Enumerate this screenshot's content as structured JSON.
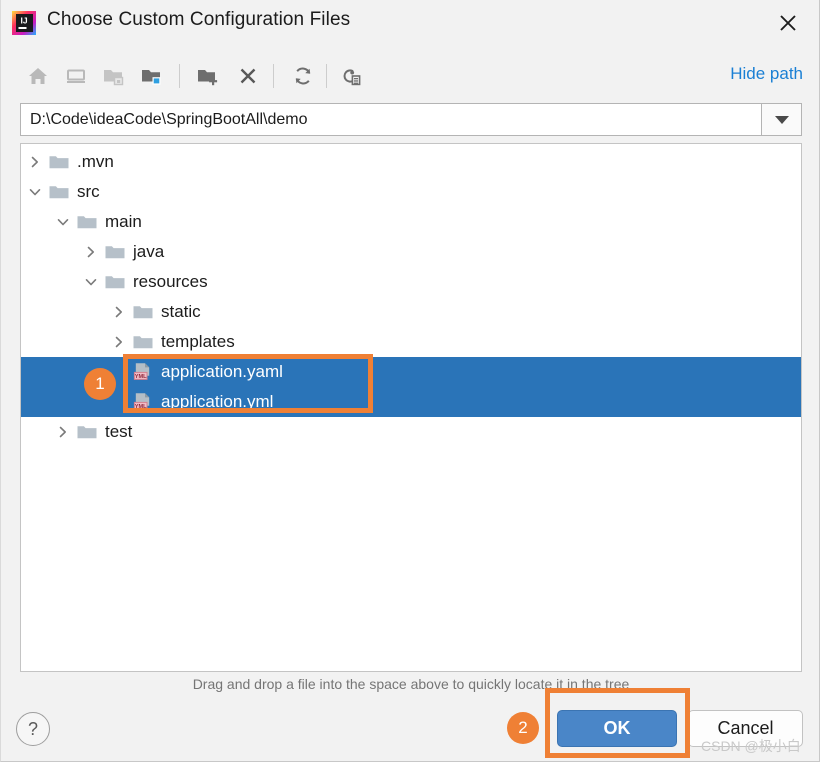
{
  "window": {
    "title": "Choose Custom Configuration Files",
    "app_icon": "intellij-idea-logo",
    "close_icon": "close-icon"
  },
  "toolbar": {
    "items": [
      {
        "name": "home-icon",
        "tooltip": "Home"
      },
      {
        "name": "desktop-icon",
        "tooltip": "Desktop"
      },
      {
        "name": "project-folder-icon",
        "tooltip": "Project Directory"
      },
      {
        "name": "module-folder-icon",
        "tooltip": "Module Directory"
      },
      {
        "name": "new-folder-icon",
        "tooltip": "New Folder"
      },
      {
        "name": "delete-icon",
        "tooltip": "Delete"
      },
      {
        "name": "refresh-icon",
        "tooltip": "Refresh"
      },
      {
        "name": "show-hidden-icon",
        "tooltip": "Show Hidden Files"
      }
    ],
    "hide_path_label": "Hide path"
  },
  "path_field": {
    "value": "D:\\Code\\ideaCode\\SpringBootAll\\demo",
    "placeholder": "",
    "dropdown_icon": "chevron-down-icon"
  },
  "tree": {
    "rows": [
      {
        "label": ".mvn",
        "depth": 0,
        "type": "folder",
        "state": "collapsed",
        "selected": false
      },
      {
        "label": "src",
        "depth": 0,
        "type": "folder",
        "state": "expanded",
        "selected": false
      },
      {
        "label": "main",
        "depth": 1,
        "type": "folder",
        "state": "expanded",
        "selected": false
      },
      {
        "label": "java",
        "depth": 2,
        "type": "folder",
        "state": "collapsed",
        "selected": false
      },
      {
        "label": "resources",
        "depth": 2,
        "type": "folder",
        "state": "expanded",
        "selected": false
      },
      {
        "label": "static",
        "depth": 3,
        "type": "folder",
        "state": "collapsed",
        "selected": false
      },
      {
        "label": "templates",
        "depth": 3,
        "type": "folder",
        "state": "collapsed",
        "selected": false
      },
      {
        "label": "application.yaml",
        "depth": 3,
        "type": "yml",
        "state": "leaf",
        "selected": true
      },
      {
        "label": "application.yml",
        "depth": 3,
        "type": "yml",
        "state": "leaf",
        "selected": true
      },
      {
        "label": "test",
        "depth": 1,
        "type": "folder",
        "state": "collapsed",
        "selected": false
      }
    ]
  },
  "footer": {
    "drag_hint": "Drag and drop a file into the space above to quickly locate it in the tree",
    "help_label": "?",
    "ok_label": "OK",
    "cancel_label": "Cancel"
  },
  "watermark": {
    "text": "CSDN @极小白"
  },
  "annotations": {
    "badge_1": "1",
    "badge_2": "2"
  },
  "colors": {
    "selection_blue": "#2a74b8",
    "annotation_orange": "#ef8035",
    "link_blue": "#1a7fd4",
    "ok_button_blue": "#4a86c8",
    "dialog_background": "#f2f2f2"
  }
}
